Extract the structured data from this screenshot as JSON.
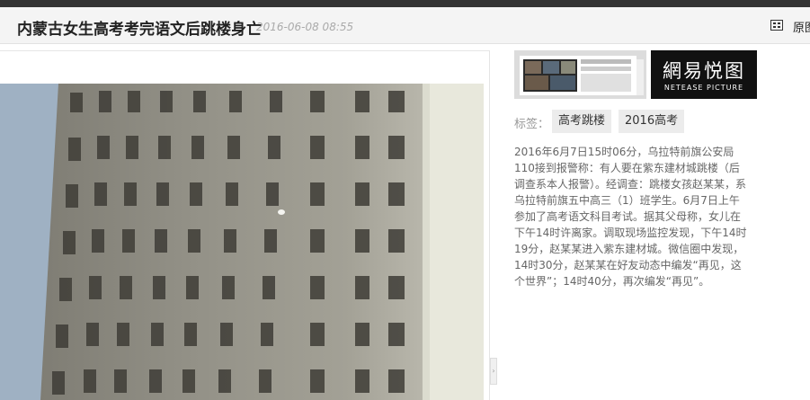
{
  "header": {
    "title": "内蒙古女生高考考完语文后跳楼身亡",
    "date": "2016-06-08 08:55",
    "original_label": "原图"
  },
  "sidebar": {
    "logo_cn": "網易悦图",
    "logo_en": "NETEASE PICTURE",
    "tags_label": "标签：",
    "tags": [
      "高考跳楼",
      "2016高考"
    ],
    "description": "2016年6月7日15时06分，乌拉特前旗公安局110接到报警称：有人要在紫东建材城跳楼（后调查系本人报警）。经调查：跳楼女孩赵某某，系乌拉特前旗五中高三（1）班学生。6月7日上午参加了高考语文科目考试。据其父母称，女儿在下午14时许离家。调取现场监控发现，下午14时19分，赵某某进入紫东建材城。微信圈中发现，14时30分，赵某某在好友动态中编发“再见，这个世界”；14时40分，再次编发“再见”。"
  }
}
